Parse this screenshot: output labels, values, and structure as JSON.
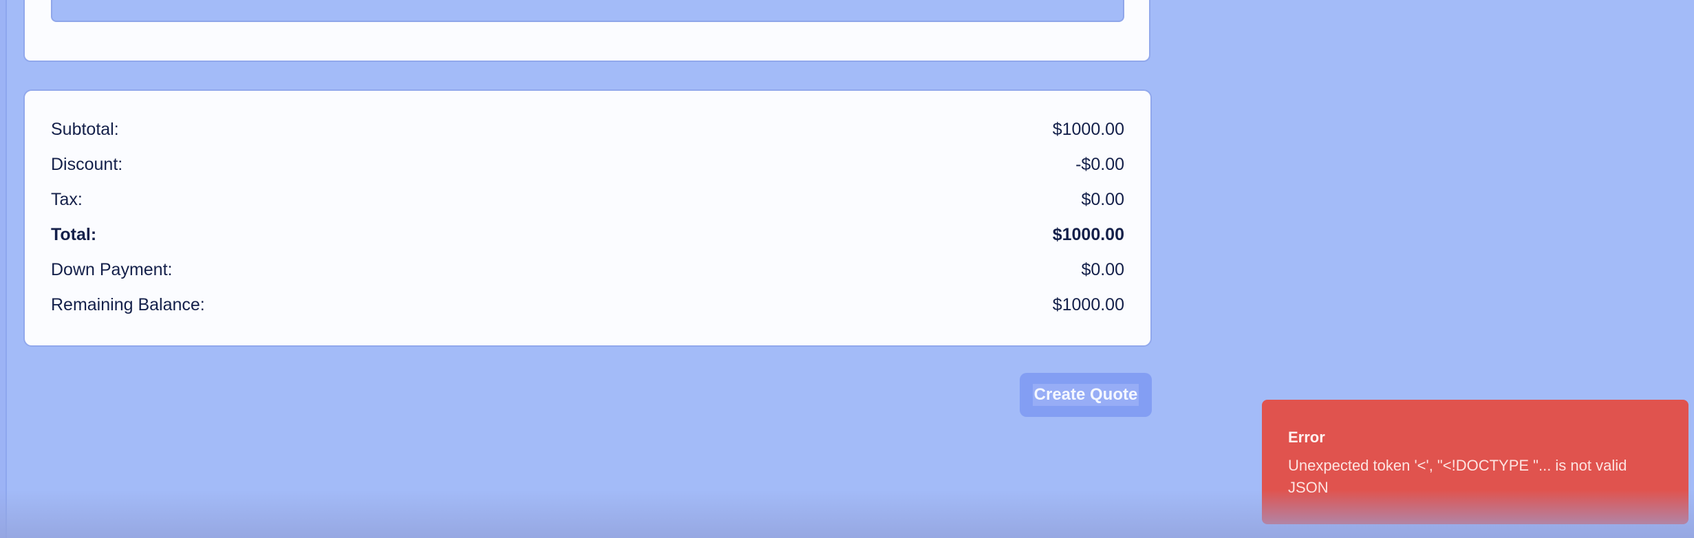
{
  "summary": {
    "rows": [
      {
        "label": "Subtotal:",
        "value": "$1000.00"
      },
      {
        "label": "Discount:",
        "value": "-$0.00"
      },
      {
        "label": "Tax:",
        "value": "$0.00"
      },
      {
        "label": "Total:",
        "value": "$1000.00"
      },
      {
        "label": "Down Payment:",
        "value": "$0.00"
      },
      {
        "label": "Remaining Balance:",
        "value": "$1000.00"
      }
    ]
  },
  "actions": {
    "create_quote_label": "Create Quote"
  },
  "toast": {
    "title": "Error",
    "message": "Unexpected token '<', \"<!DOCTYPE \"... is not valid JSON"
  },
  "colors": {
    "page_background": "#a3bbf8",
    "card_background": "#fbfcff",
    "button_background": "#839ef3",
    "error_toast": "#e0534e",
    "text_primary": "#14204a"
  }
}
